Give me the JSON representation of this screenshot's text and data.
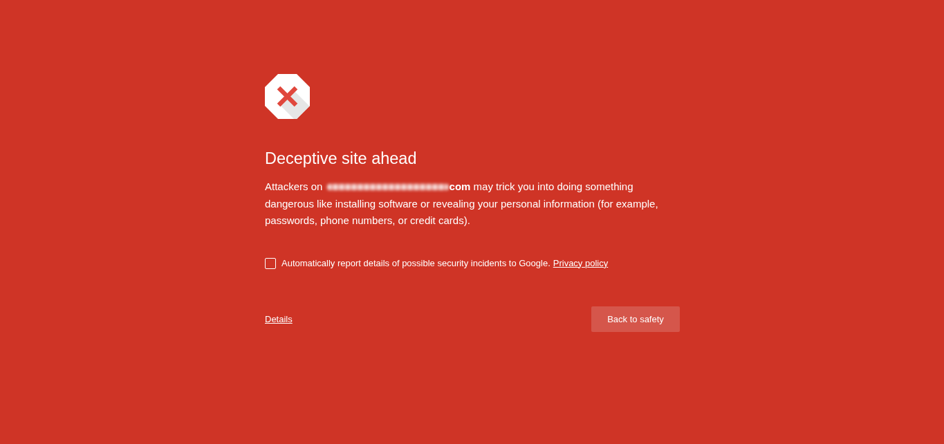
{
  "heading": "Deceptive site ahead",
  "warning": {
    "lead": "Attackers on",
    "domain_redacted": true,
    "text": "**com** may trick you into doing something dangerous like installing software or revealing your personal information (for example, passwords, phone numbers, or credit cards)."
  },
  "report_option": {
    "checked": false,
    "label": "Automatically report details of possible security incidents to Google.",
    "link": "Privacy policy"
  },
  "details_link": "Details",
  "back_button": "Back to safety"
}
